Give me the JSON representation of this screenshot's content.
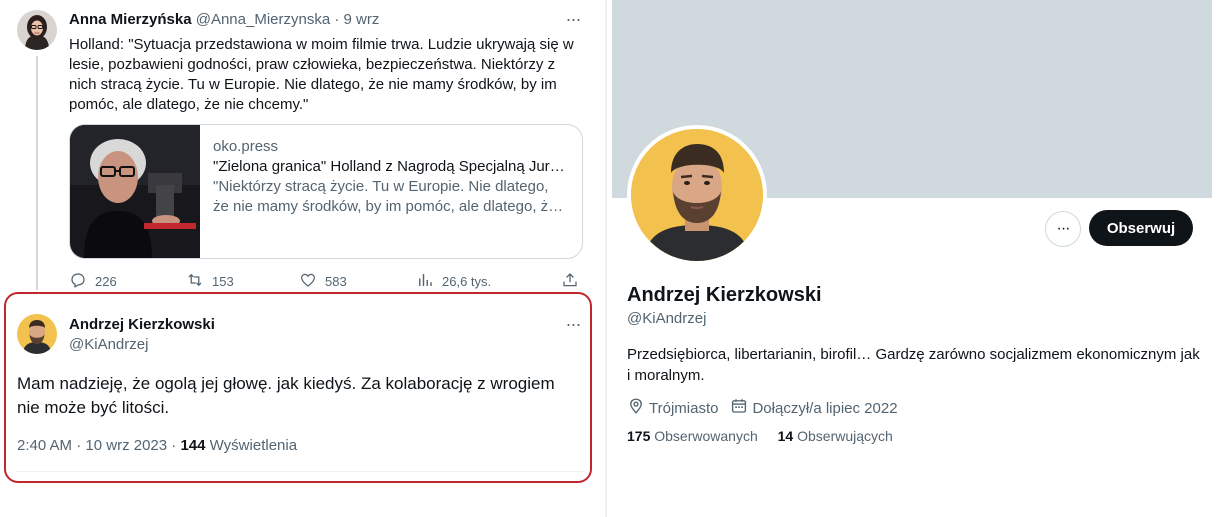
{
  "tweet1": {
    "author_name": "Anna Mierzyńska",
    "author_handle": "@Anna_Mierzynska",
    "separator": "·",
    "date": "9 wrz",
    "text": "Holland: \"Sytuacja przedstawiona w moim filmie trwa. Ludzie ukrywają się w lesie, pozbawieni godności, praw człowieka, bezpieczeństwa. Niektórzy z nich stracą życie. Tu w Europie. Nie dlatego, że nie mamy środków, by im pomóc, ale dlatego, że nie chcemy.\"",
    "card": {
      "domain": "oko.press",
      "title": "\"Zielona granica\" Holland z Nagrodą Specjalną Jury w Wenecji",
      "description": "\"Niektórzy stracą życie. Tu w Europie. Nie dlatego, że nie mamy środków, by im pomóc, ale dlatego, ż…"
    },
    "stats": {
      "replies": "226",
      "retweets": "153",
      "likes": "583",
      "views": "26,6 tys."
    }
  },
  "tweet2": {
    "author_name": "Andrzej Kierzkowski",
    "author_handle": "@KiAndrzej",
    "text": "Mam nadzieję, że ogolą jej głowę. jak kiedyś. Za kolaborację z wrogiem nie może być litości.",
    "time": "2:40 AM",
    "date": "10 wrz 2023",
    "views_count": "144",
    "views_label": "Wyświetlenia"
  },
  "profile": {
    "name": "Andrzej Kierzkowski",
    "handle": "@KiAndrzej",
    "follow_label": "Obserwuj",
    "bio": "Przedsiębiorca, libertarianin, birofil… Gardzę zarówno socjalizmem ekonomicznym jak i moralnym.",
    "location": "Trójmiasto",
    "joined": "Dołączył/a lipiec 2022",
    "following_count": "175",
    "following_label": "Obserwowanych",
    "followers_count": "14",
    "followers_label": "Obserwujących"
  },
  "icons": {
    "more": "more-icon",
    "reply": "reply-icon",
    "retweet": "retweet-icon",
    "like": "heart-icon",
    "views": "views-icon",
    "share": "share-icon",
    "location": "location-pin-icon",
    "calendar": "calendar-icon"
  },
  "colors": {
    "highlight_border": "#c0282d",
    "banner": "#cfd9de",
    "follow_button": "#0f1419",
    "secondary_text": "#536471"
  }
}
